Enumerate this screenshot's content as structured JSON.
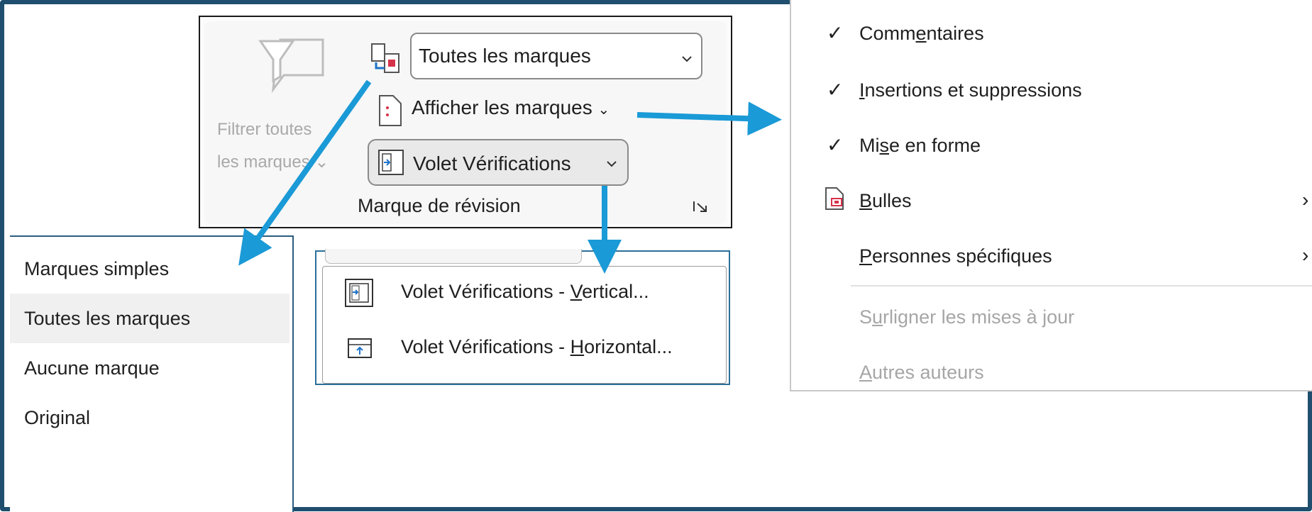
{
  "ribbon": {
    "filter_label_line1": "Filtrer toutes",
    "filter_label_line2": "les marques",
    "markup_combo_value": "Toutes les marques",
    "show_markup_label": "Afficher les marques",
    "reviewing_pane_label": "Volet Vérifications",
    "group_label": "Marque de révision",
    "launcher_icon": "dialog-launcher-icon"
  },
  "markup_menu": {
    "items": [
      "Marques simples",
      "Toutes les marques",
      "Aucune marque",
      "Original"
    ],
    "selected": "Toutes les marques"
  },
  "reviewing_pane_menu": {
    "items": [
      {
        "pre": "Volet Vérifications - ",
        "accel": "V",
        "post": "ertical..."
      },
      {
        "pre": "Volet Vérifications - ",
        "accel": "H",
        "post": "orizontal..."
      }
    ]
  },
  "show_markup_menu": {
    "items": [
      {
        "pre": "Comm",
        "accel": "e",
        "post": "ntaires",
        "checked": true,
        "enabled": true
      },
      {
        "pre": "",
        "accel": "I",
        "post": "nsertions et suppressions",
        "checked": true,
        "enabled": true
      },
      {
        "pre": "Mi",
        "accel": "s",
        "post": "e en forme",
        "checked": true,
        "enabled": true
      },
      {
        "pre": "",
        "accel": "B",
        "post": "ulles",
        "checked": false,
        "enabled": true,
        "submenu": true
      },
      {
        "pre": "",
        "accel": "P",
        "post": "ersonnes spécifiques",
        "checked": false,
        "enabled": true,
        "submenu": true
      },
      {
        "pre": "S",
        "accel": "u",
        "post": "rligner les mises à jour",
        "checked": false,
        "enabled": false
      },
      {
        "pre": "",
        "accel": "A",
        "post": "utres auteurs",
        "checked": false,
        "enabled": false
      }
    ]
  },
  "colors": {
    "frame": "#1f4e6e",
    "arrow": "#1a9ad6",
    "disabled_text": "#a6a6a6"
  }
}
